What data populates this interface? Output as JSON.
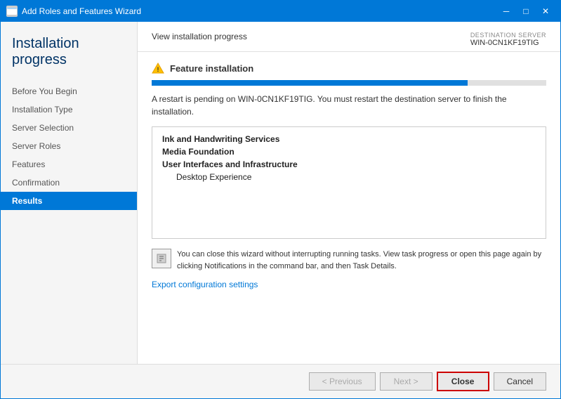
{
  "window": {
    "title": "Add Roles and Features Wizard",
    "icon": "wizard-icon"
  },
  "title_controls": {
    "minimize": "─",
    "maximize": "□",
    "close": "✕"
  },
  "sidebar": {
    "header_title": "Installation progress",
    "items": [
      {
        "label": "Before You Begin",
        "active": false
      },
      {
        "label": "Installation Type",
        "active": false
      },
      {
        "label": "Server Selection",
        "active": false
      },
      {
        "label": "Server Roles",
        "active": false
      },
      {
        "label": "Features",
        "active": false
      },
      {
        "label": "Confirmation",
        "active": false
      },
      {
        "label": "Results",
        "active": true
      }
    ]
  },
  "main": {
    "section_title": "View installation progress",
    "destination_label": "DESTINATION SERVER",
    "destination_name": "WIN-0CN1KF19TIG",
    "feature_installation_label": "Feature installation",
    "progress_percent": 80,
    "restart_message": "A restart is pending on WIN-0CN1KF19TIG. You must restart the destination server to finish the installation.",
    "features": [
      {
        "label": "Ink and Handwriting Services",
        "indent": false,
        "bold": true
      },
      {
        "label": "Media Foundation",
        "indent": false,
        "bold": true
      },
      {
        "label": "User Interfaces and Infrastructure",
        "indent": false,
        "bold": true
      },
      {
        "label": "Desktop Experience",
        "indent": true,
        "bold": false
      }
    ],
    "info_text": "You can close this wizard without interrupting running tasks. View task progress or open this page again by clicking Notifications in the command bar, and then Task Details.",
    "export_link": "Export configuration settings"
  },
  "footer": {
    "previous_label": "< Previous",
    "next_label": "Next >",
    "close_label": "Close",
    "cancel_label": "Cancel"
  }
}
